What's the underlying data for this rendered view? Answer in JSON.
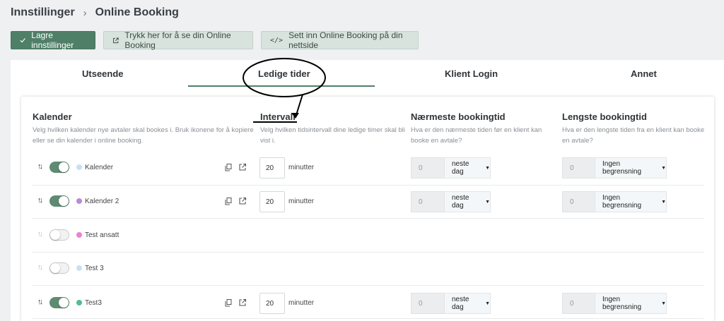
{
  "breadcrumb": {
    "parent": "Innstillinger",
    "separator": "›",
    "current": "Online Booking"
  },
  "toolbar": {
    "save": "Lagre innstillinger",
    "view": "Trykk her for å se din Online Booking",
    "embed": "Sett inn Online Booking på din nettside"
  },
  "tabs": [
    {
      "label": "Utseende"
    },
    {
      "label": "Ledige tider",
      "active": true
    },
    {
      "label": "Klient Login"
    },
    {
      "label": "Annet"
    }
  ],
  "columns": {
    "kalender": {
      "title": "Kalender",
      "desc1": "Velg hvilken kalender nye avtaler skal bookes i. Bruk ikonene for å kopiere",
      "desc2": "eller se din kalender i online booking."
    },
    "intervall": {
      "title": "Intervall",
      "desc1": "Velg hvilken tidsintervall dine ledige timer skal bli",
      "desc2": "vist i."
    },
    "naermeste": {
      "title": "Nærmeste bookingtid",
      "desc1": "Hva er den nærmeste tiden før en klient kan",
      "desc2": "booke en avtale?"
    },
    "lengste": {
      "title": "Lengste bookingtid",
      "desc1": "Hva er den lengste tiden fra en klient kan booke",
      "desc2": "en avtale?"
    }
  },
  "rows": [
    {
      "name": "Kalender",
      "enabled": true,
      "dot_color": "#c9e0f2",
      "interval": "20",
      "unit": "minutter",
      "near_value": "0",
      "near_unit": "neste dag",
      "far_value": "0",
      "far_unit": "Ingen begrensning"
    },
    {
      "name": "Kalender 2",
      "enabled": true,
      "dot_color": "#b98ad8",
      "interval": "20",
      "unit": "minutter",
      "near_value": "0",
      "near_unit": "neste dag",
      "far_value": "0",
      "far_unit": "Ingen begrensning"
    },
    {
      "name": "Test ansatt",
      "enabled": false,
      "dot_color": "#ee7fd4"
    },
    {
      "name": "Test 3",
      "enabled": false,
      "dot_color": "#c9e0f2"
    },
    {
      "name": "Test3",
      "enabled": true,
      "dot_color": "#4fbf8c",
      "interval": "20",
      "unit": "minutter",
      "near_value": "0",
      "near_unit": "neste dag",
      "far_value": "0",
      "far_unit": "Ingen begrensning"
    }
  ],
  "colors": {
    "primary": "#4f7f67",
    "light_button": "#d8e3dd",
    "annotation": "#000000"
  }
}
